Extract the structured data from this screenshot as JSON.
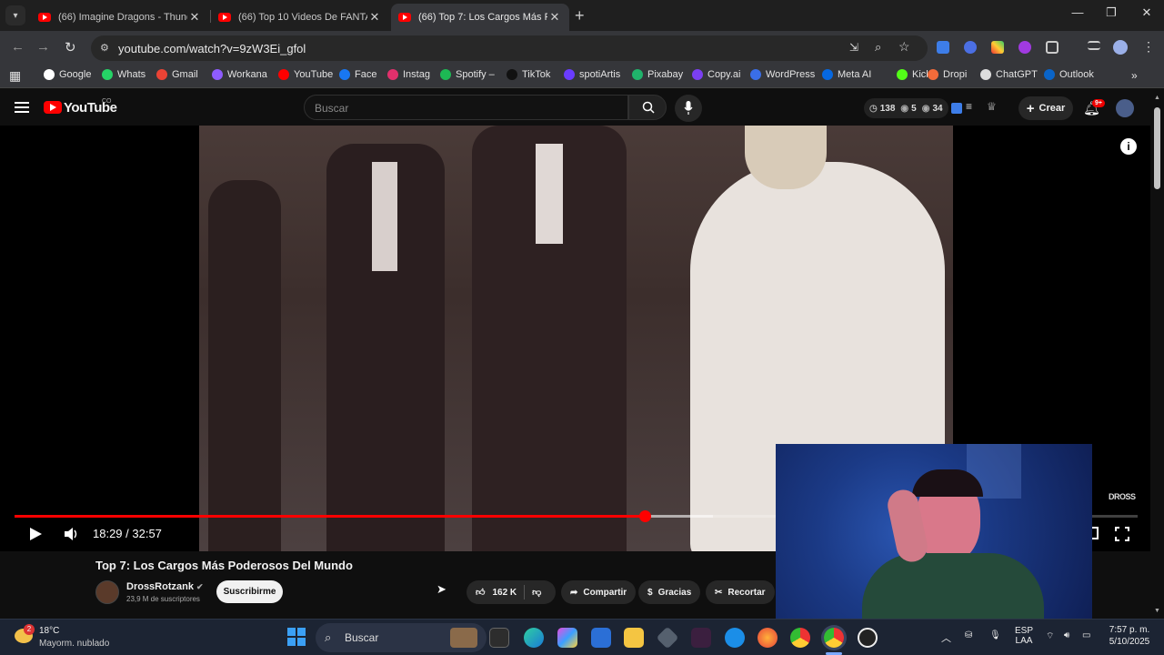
{
  "browser": {
    "tabs": [
      {
        "label": "(66) Imagine Dragons - Thunde",
        "active": false
      },
      {
        "label": "(66) Top 10 Videos De FANTASM",
        "active": false
      },
      {
        "label": "(66) Top 7: Los Cargos Más Pod",
        "active": true
      }
    ],
    "url": "youtube.com/watch?v=9zW3Ei_gfol",
    "bookmarks": [
      "Google",
      "Whats",
      "Gmail",
      "Workana",
      "YouTube",
      "Face",
      "Instag",
      "Spotify –",
      "TikTok",
      "spotiArtis",
      "Pixabay",
      "Copy.ai",
      "WordPress",
      "Meta AI",
      "Kick",
      "Dropi",
      "ChatGPT",
      "Outlook"
    ],
    "bookmark_colors": [
      "#ffffff",
      "#25d366",
      "#ea4335",
      "#8e5cff",
      "#ff0000",
      "#1877f2",
      "#e1306c",
      "#1db954",
      "#111111",
      "#6a3cff",
      "#20b36b",
      "#7b3ff2",
      "#3a6ee8",
      "#0668e1",
      "#53fc18",
      "#f26b3a",
      "#dddddd",
      "#0a64c8"
    ]
  },
  "youtube": {
    "logo_text": "YouTube",
    "country_code": "CO",
    "search_placeholder": "Buscar",
    "stats": {
      "a": "138",
      "b": "5",
      "c": "34"
    },
    "create_label": "Crear",
    "notif_badge": "9+",
    "watermark": "DROSS"
  },
  "video": {
    "current_time": "18:29 / 32:57",
    "progress": 0.5614,
    "buffered_end": 0.622,
    "title": "Top 7: Los Cargos Más Poderosos Del Mundo",
    "channel": "DrossRotzank",
    "subscribers": "23,9 M de suscriptores",
    "subscribe_label": "Suscribirme",
    "likes": "162 K",
    "share_label": "Compartir",
    "thanks_label": "Gracias",
    "clip_label": "Recortar"
  },
  "taskbar": {
    "weather_temp": "18°C",
    "weather_desc": "Mayorm. nublado",
    "weather_badge": "2",
    "search_placeholder": "Buscar",
    "lang_line1": "ESP",
    "lang_line2": "LAA",
    "clock_time": "7:57 p. m.",
    "clock_date": "5/10/2025"
  }
}
